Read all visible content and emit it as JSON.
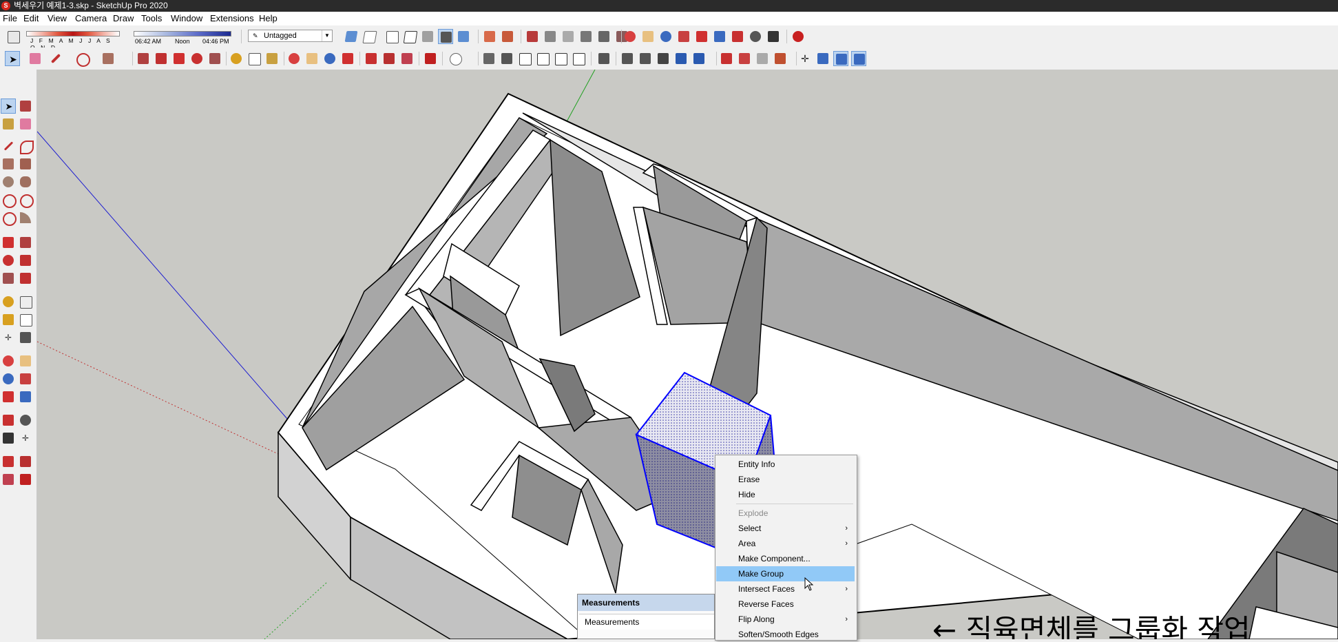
{
  "window": {
    "title": "벽세우기 예제1-3.skp - SketchUp Pro 2020"
  },
  "menu": [
    "File",
    "Edit",
    "View",
    "Camera",
    "Draw",
    "Tools",
    "Window",
    "Extensions",
    "Help"
  ],
  "shadows": {
    "months": "J F M A M J J A S O N D",
    "time_start": "06:42 AM",
    "time_mid": "Noon",
    "time_end": "04:46 PM"
  },
  "tag": {
    "selected": "Untagged"
  },
  "context_menu": {
    "items": [
      {
        "label": "Entity Info"
      },
      {
        "label": "Erase"
      },
      {
        "label": "Hide"
      },
      {
        "label": "Explode",
        "disabled": true
      },
      {
        "label": "Select",
        "submenu": true
      },
      {
        "label": "Area",
        "submenu": true
      },
      {
        "label": "Make Component..."
      },
      {
        "label": "Make Group",
        "highlighted": true
      },
      {
        "label": "Intersect Faces",
        "submenu": true
      },
      {
        "label": "Reverse Faces"
      },
      {
        "label": "Flip Along",
        "submenu": true
      },
      {
        "label": "Soften/Smooth Edges"
      }
    ]
  },
  "measurements": {
    "title": "Measurements",
    "label": "Measurements"
  },
  "annotation": {
    "text": "← 직육면체를 그룹화 작업"
  },
  "colors": {
    "accent_selected": "#0000ff",
    "menu_highlight": "#91c9f7",
    "viewport_bg": "#c9c9c5"
  }
}
